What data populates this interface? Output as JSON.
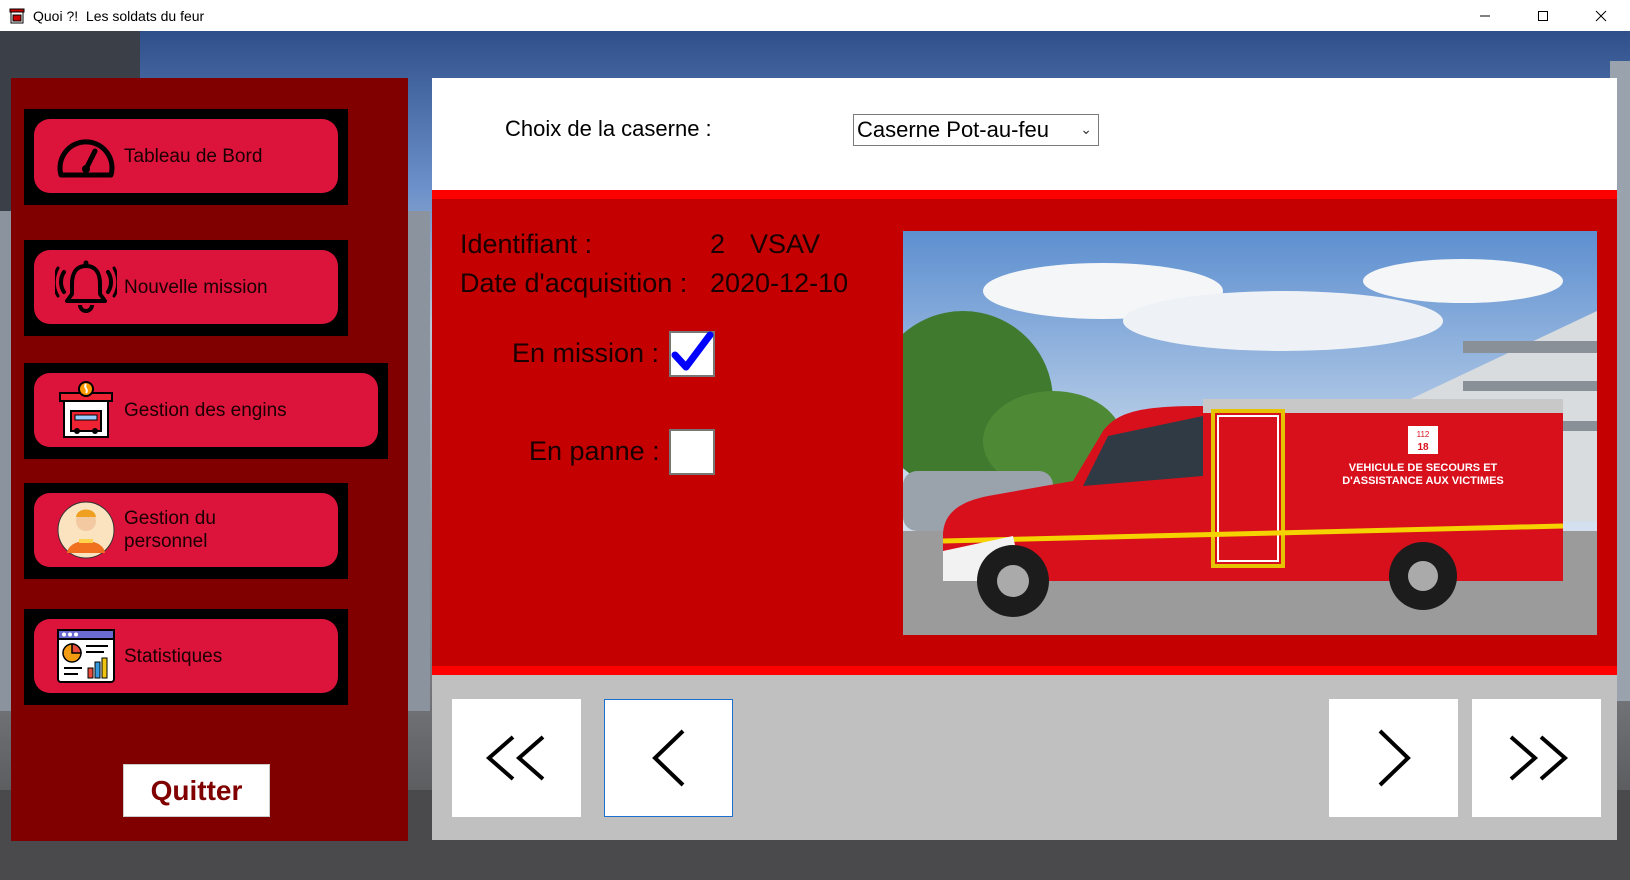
{
  "window": {
    "title": "Quoi ?!  Les soldats du feur",
    "controls": [
      "minimize-icon",
      "maximize-icon",
      "close-icon"
    ]
  },
  "sidebar": {
    "items": [
      {
        "label": "Tableau de Bord",
        "icon": "dashboard-gauge-icon"
      },
      {
        "label": "Nouvelle mission",
        "icon": "alarm-bell-icon"
      },
      {
        "label": "Gestion des engins",
        "icon": "fire-station-icon"
      },
      {
        "label": "Gestion du personnel",
        "icon": "firefighter-avatar-icon"
      },
      {
        "label": "Statistiques",
        "icon": "statistics-chart-icon"
      }
    ],
    "quit_label": "Quitter"
  },
  "header": {
    "caserne_label": "Choix de la caserne :",
    "caserne_selected": "Caserne Pot-au-feu"
  },
  "vehicle": {
    "id_label": "Identifiant :",
    "id_value": "2",
    "type_value": "VSAV",
    "date_label": "Date d'acquisition :",
    "date_value": "2020-12-10",
    "mission_label": "En mission :",
    "mission_checked": true,
    "panne_label": "En panne :",
    "panne_checked": false,
    "photo_text_line1": "VEHICULE DE SECOURS ET",
    "photo_text_line2": "D'ASSISTANCE AUX VICTIMES",
    "photo_badge_top": "112",
    "photo_badge_bottom": "18"
  },
  "pager": {
    "first_icon": "double-chevron-left-icon",
    "prev_icon": "chevron-left-icon",
    "next_icon": "chevron-right-icon",
    "last_icon": "double-chevron-right-icon"
  },
  "colors": {
    "sidebar_bg": "#800000",
    "nav_button": "#dc143c",
    "red_panel": "#c40000",
    "red_line": "#ff0000",
    "check_mark": "#0000ff"
  }
}
